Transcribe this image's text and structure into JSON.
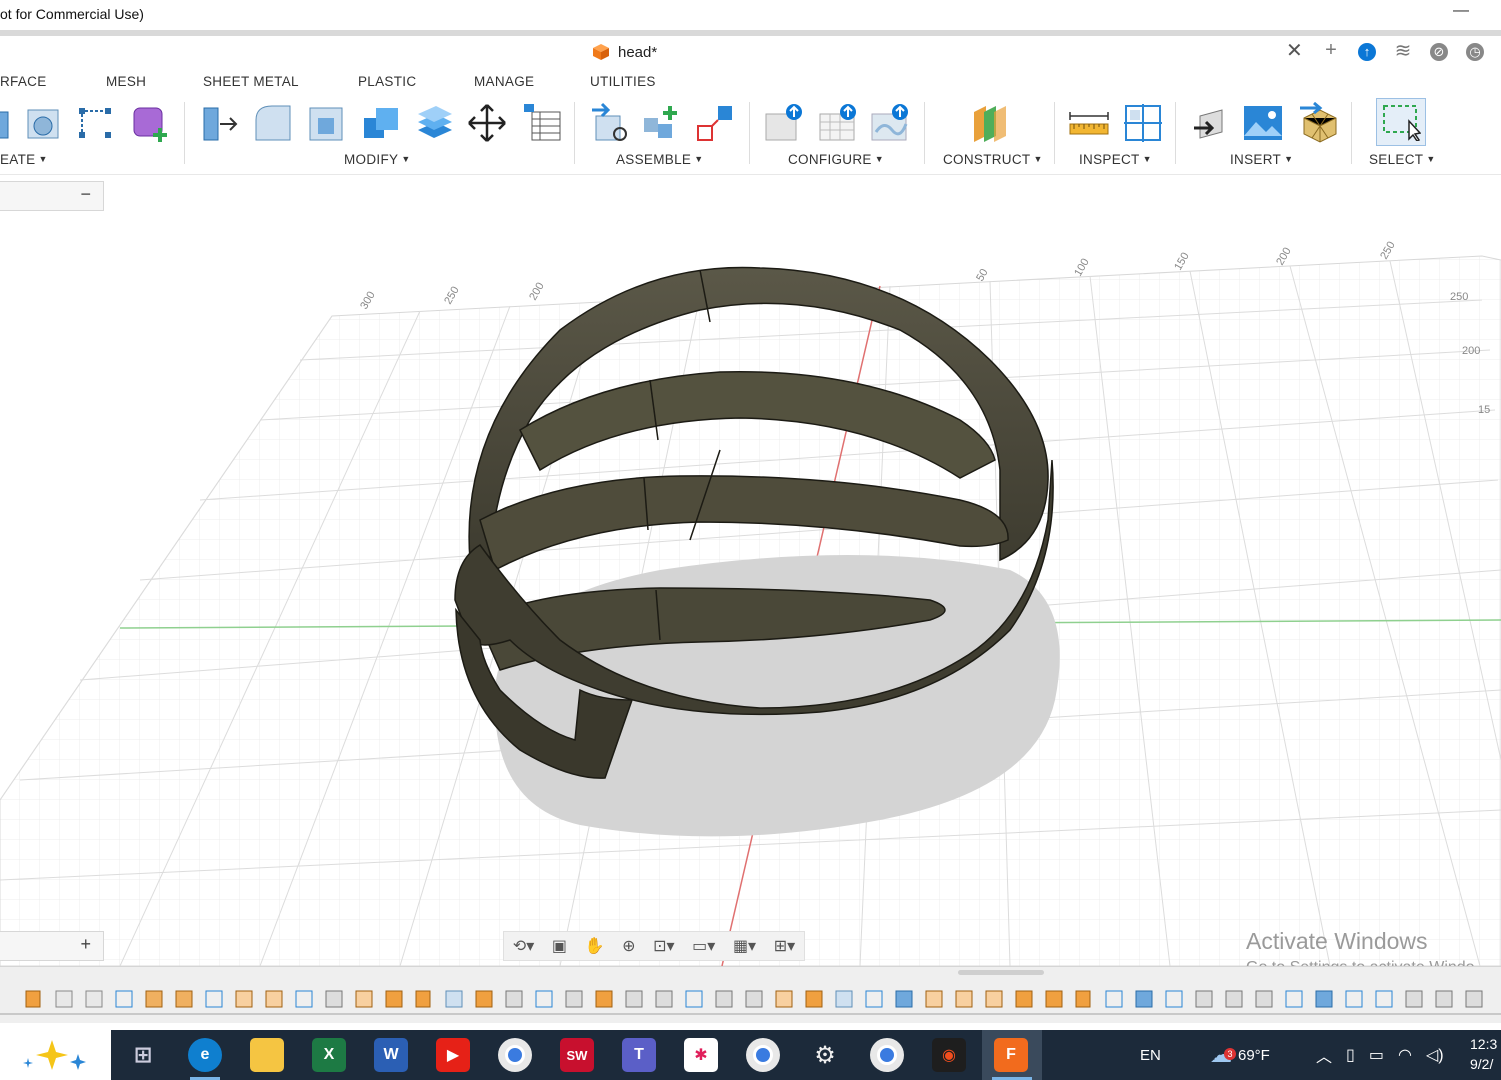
{
  "window": {
    "title_fragment": "ot for Commercial Use)",
    "minimize": "—"
  },
  "document_tab": {
    "name": "head*",
    "close": "✕"
  },
  "tab_actions": {
    "new_tab": "+",
    "job_status": "↑",
    "extensions": "≋",
    "notifications": "⊘",
    "help": "◷"
  },
  "workspace_tabs": [
    "RFACE",
    "MESH",
    "SHEET METAL",
    "PLASTIC",
    "MANAGE",
    "UTILITIES"
  ],
  "toolbar_groups": {
    "create": "EATE",
    "modify": "MODIFY",
    "assemble": "ASSEMBLE",
    "configure": "CONFIGURE",
    "construct": "CONSTRUCT",
    "inspect": "INSPECT",
    "insert": "INSERT",
    "select": "SELECT"
  },
  "browser_panel": {
    "collapse": "−"
  },
  "comments_panel": {
    "expand": "+"
  },
  "viewport": {
    "grid_labels_top": [
      "300",
      "250",
      "200",
      "50",
      "100",
      "150",
      "200",
      "250"
    ],
    "grid_labels_right": [
      "250",
      "200",
      "15"
    ],
    "model_color": "#4a4838",
    "shadow_color": "#d4d4d4"
  },
  "watermark": {
    "line1": "Activate Windows",
    "line2": "Go to Settings to activate Windo"
  },
  "taskbar": {
    "language": "EN",
    "weather_temp": "69°F",
    "weather_badge": "3",
    "time": "12:3",
    "date": "9/2/"
  },
  "colors": {
    "accent": "#0b77d6",
    "taskbar": "#1c2a3a",
    "timeline_bg": "#efefef"
  }
}
